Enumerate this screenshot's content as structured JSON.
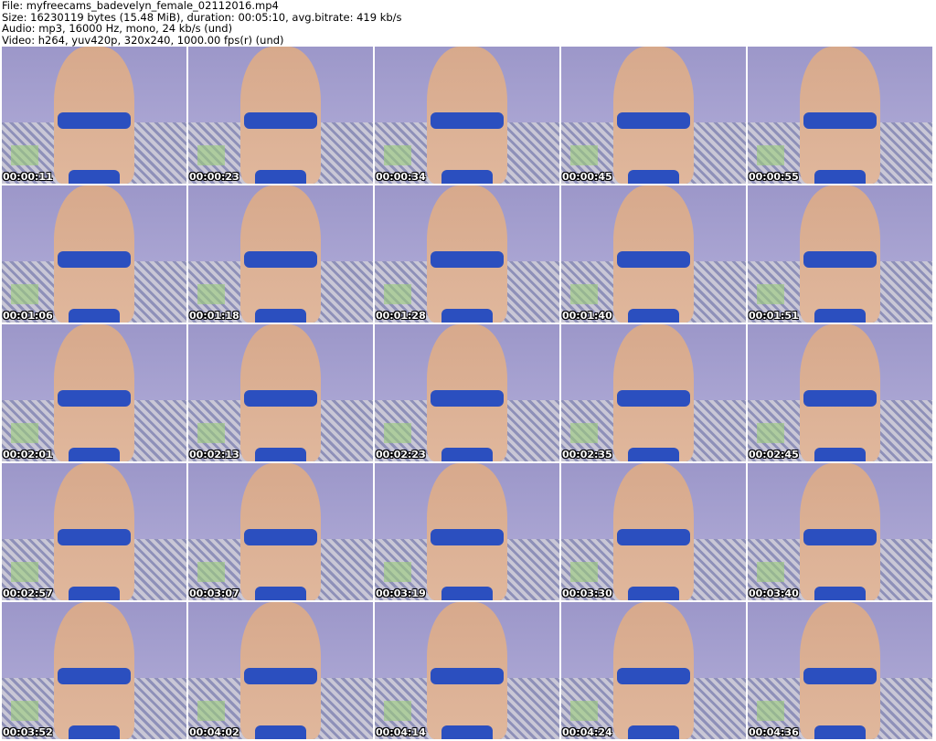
{
  "info": {
    "file": "File: myfreecams_badevelyn_female_02112016.mp4",
    "size": "Size: 16230119 bytes (15.48 MiB), duration: 00:05:10, avg.bitrate: 419 kb/s",
    "audio": "Audio: mp3, 16000 Hz, mono, 24 kb/s (und)",
    "video": "Video: h264, yuv420p, 320x240, 1000.00 fps(r) (und)"
  },
  "thumbnails": [
    "00:00:11",
    "00:00:23",
    "00:00:34",
    "00:00:45",
    "00:00:55",
    "00:01:06",
    "00:01:18",
    "00:01:28",
    "00:01:40",
    "00:01:51",
    "00:02:01",
    "00:02:13",
    "00:02:23",
    "00:02:35",
    "00:02:45",
    "00:02:57",
    "00:03:07",
    "00:03:19",
    "00:03:30",
    "00:03:40",
    "00:03:52",
    "00:04:02",
    "00:04:14",
    "00:04:24",
    "00:04:36"
  ]
}
